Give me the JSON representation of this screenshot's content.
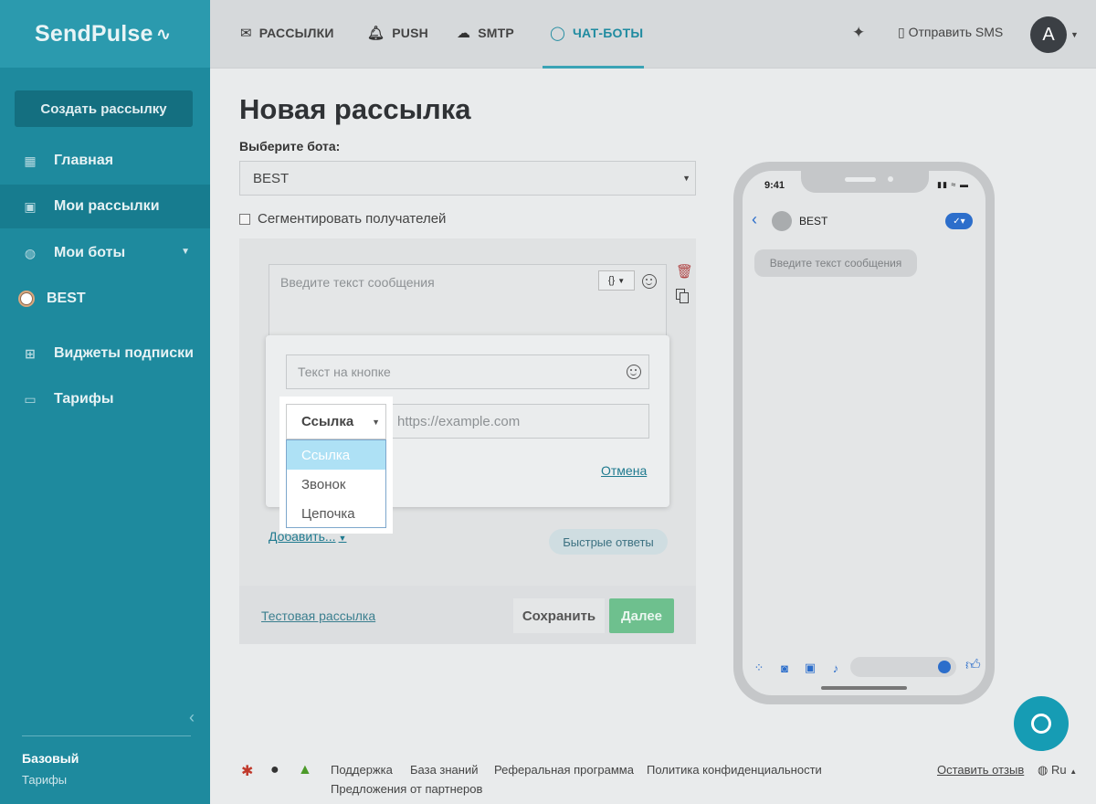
{
  "app": {
    "logo": "SendPulse",
    "accent": "#1f8ba0"
  },
  "sidebar": {
    "create_button": "Создать рассылку",
    "items": [
      {
        "label": "Главная",
        "icon": "dashboard-icon"
      },
      {
        "label": "Мои рассылки",
        "icon": "mailings-icon"
      },
      {
        "label": "Мои боты",
        "icon": "globe-icon"
      },
      {
        "label": "BEST",
        "icon": "messenger-icon"
      },
      {
        "label": "Виджеты подписки",
        "icon": "widget-icon"
      },
      {
        "label": "Тарифы",
        "icon": "wallet-icon"
      }
    ],
    "plan": "Базовый",
    "plan_link": "Тарифы"
  },
  "topnav": {
    "items": [
      {
        "label": "РАССЫЛКИ",
        "icon": "mail-icon"
      },
      {
        "label": "PUSH",
        "icon": "bell-icon"
      },
      {
        "label": "SMTP",
        "icon": "cloud-icon"
      },
      {
        "label": "ЧАТ-БОТЫ",
        "icon": "chat-icon"
      }
    ],
    "sms": "Отправить SMS",
    "avatar": "A"
  },
  "main": {
    "title": "Новая рассылка",
    "bot_label": "Выберите бота:",
    "bot_value": "BEST",
    "segment_label": "Сегментировать получателей",
    "message_placeholder": "Введите текст сообщения",
    "var_button": "{}",
    "add_link": "Добавить...",
    "quick_replies": "Быстрые ответы",
    "test_link": "Тестовая рассылка",
    "save_button": "Сохранить",
    "next_button": "Далее"
  },
  "popup": {
    "button_text_placeholder": "Текст на кнопке",
    "type_value": "Ссылка",
    "url_placeholder": "https://example.com",
    "cancel": "Отмена",
    "options": [
      "Ссылка",
      "Звонок",
      "Цепочка"
    ]
  },
  "phone": {
    "time": "9:41",
    "bot_name": "BEST",
    "bubble": "Введите текст сообщения"
  },
  "footer": {
    "links_row1": [
      "Поддержка",
      "База знаний",
      "Реферальная программа",
      "Политика конфиденциальности"
    ],
    "links_row2": [
      "Предложения от партнеров"
    ],
    "feedback": "Оставить отзыв",
    "lang": "Ru"
  }
}
